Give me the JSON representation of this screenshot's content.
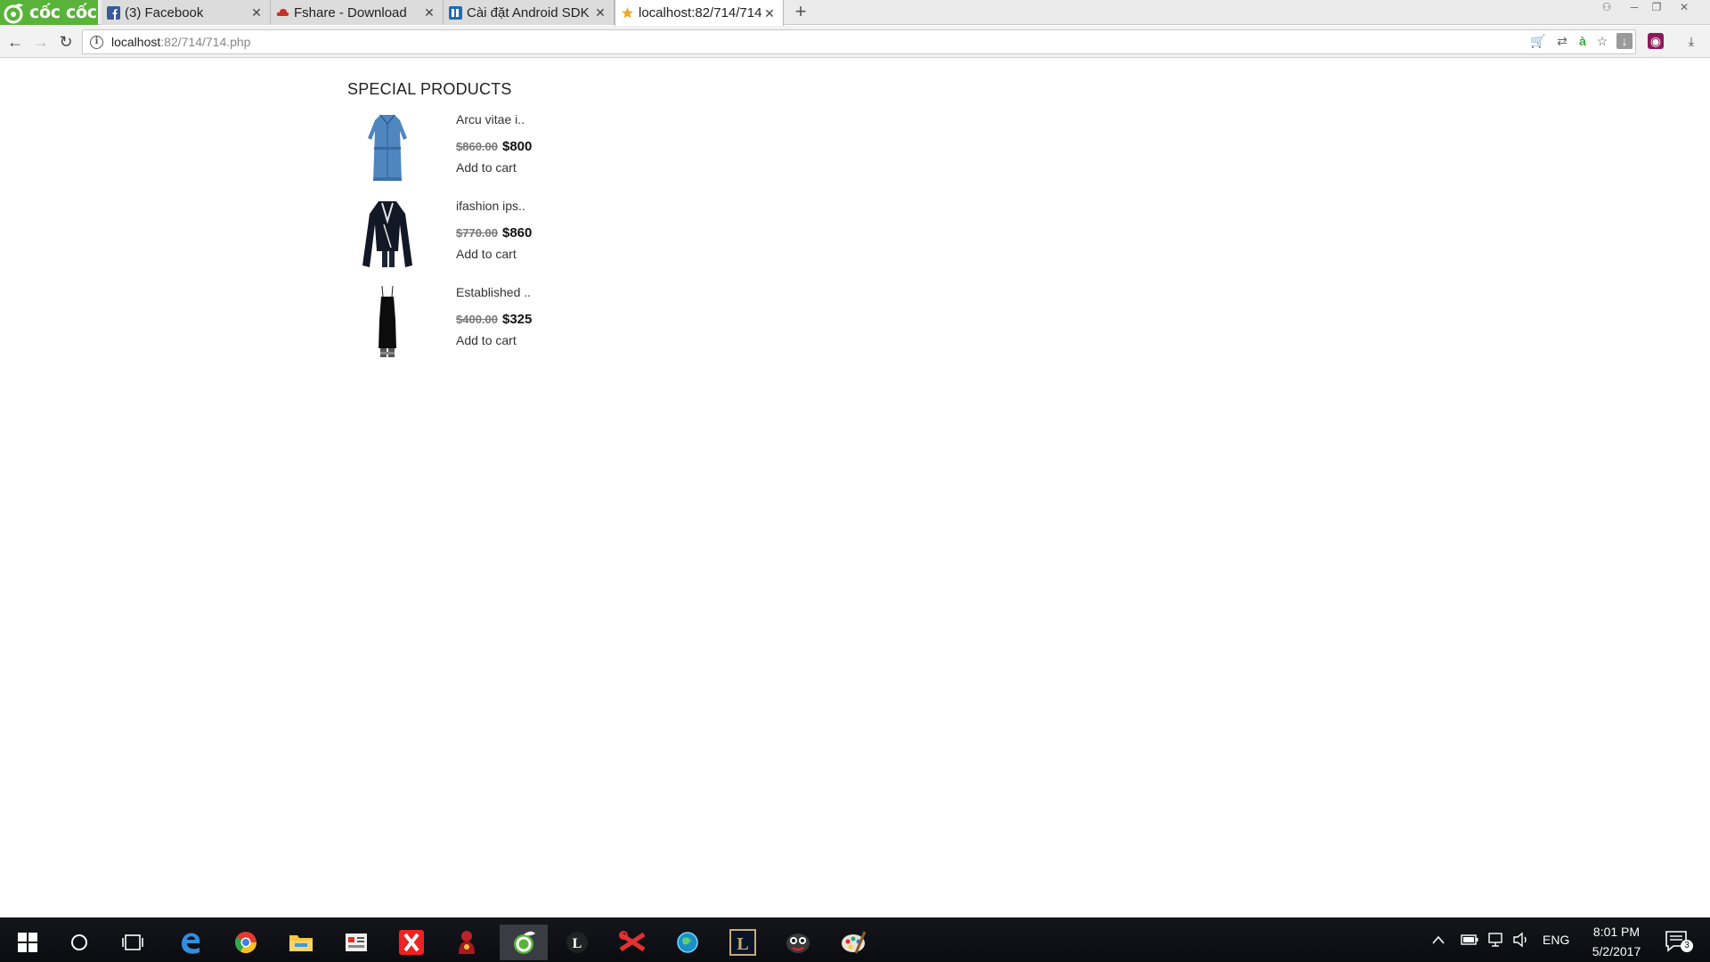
{
  "browser": {
    "brand": "cốc cốc",
    "tabs": [
      {
        "title": "(3) Facebook",
        "icon": "facebook-icon",
        "active": false
      },
      {
        "title": "Fshare - Download",
        "icon": "fshare-icon",
        "active": false
      },
      {
        "title": "Cài đặt Android SDK",
        "icon": "site-icon",
        "active": false
      },
      {
        "title": "localhost:82/714/714",
        "icon": "page-icon",
        "active": true
      }
    ],
    "url_host": "localhost",
    "url_path": ":82/714/714.php"
  },
  "page": {
    "heading": "SPECIAL PRODUCTS",
    "products": [
      {
        "name": "Arcu vitae i..",
        "old_price": "$860.00",
        "price": "$800",
        "action": "Add to cart",
        "image": "denim-dress-image"
      },
      {
        "name": "ifashion ips..",
        "old_price": "$770.00",
        "price": "$860",
        "action": "Add to cart",
        "image": "black-jacket-image"
      },
      {
        "name": "Established ..",
        "old_price": "$400.00",
        "price": "$325",
        "action": "Add to cart",
        "image": "black-dress-image"
      }
    ]
  },
  "taskbar": {
    "language": "ENG",
    "time": "8:01 PM",
    "date": "5/2/2017",
    "notifications": "3"
  }
}
